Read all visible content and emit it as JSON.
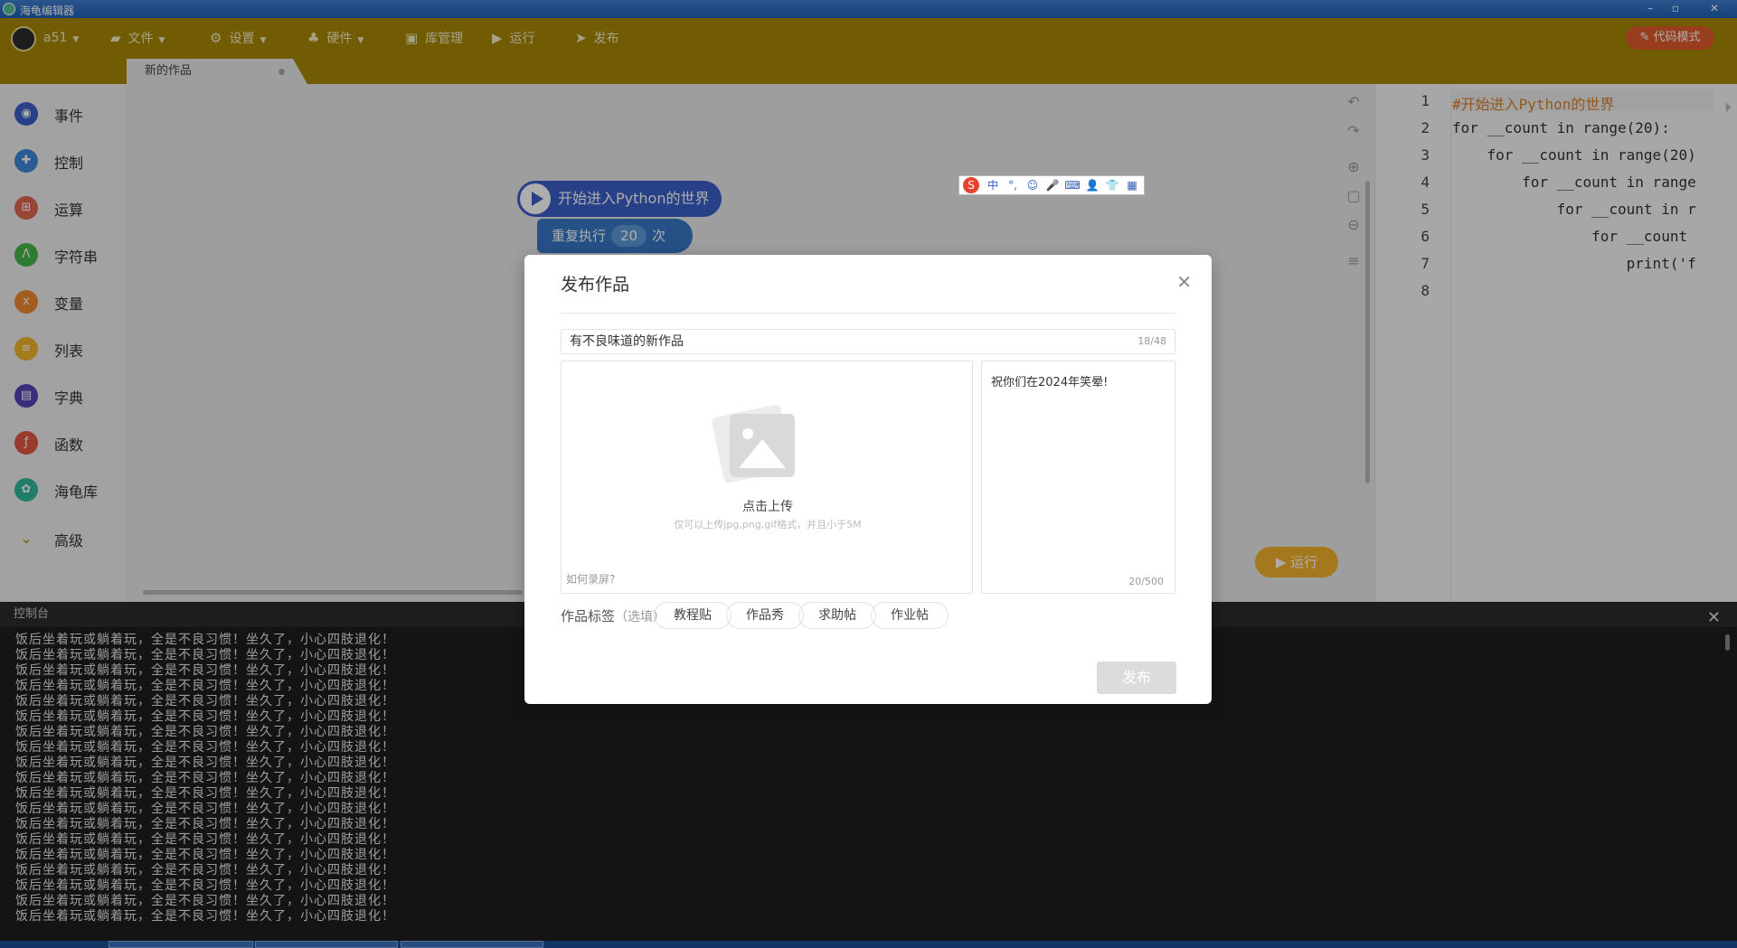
{
  "window": {
    "title": "海龟编辑器",
    "min": "–",
    "max": "▫",
    "close": "✕"
  },
  "toolbar": {
    "user": "a51",
    "file": "文件",
    "settings": "设置",
    "hardware": "硬件",
    "library": "库管理",
    "run": "运行",
    "publish": "发布",
    "code_mode": "代码模式"
  },
  "tabs": [
    {
      "label": "新的作品"
    }
  ],
  "categories": [
    {
      "label": "事件",
      "color": "#3a5fc7",
      "icon": "toggle-icon"
    },
    {
      "label": "控制",
      "color": "#3f86d8",
      "icon": "gamepad-icon"
    },
    {
      "label": "运算",
      "color": "#e0664f",
      "icon": "grid-icon"
    },
    {
      "label": "字符串",
      "color": "#46b54a",
      "icon": "a-icon"
    },
    {
      "label": "变量",
      "color": "#f08a2e",
      "icon": "x-icon"
    },
    {
      "label": "列表",
      "color": "#f1b62a",
      "icon": "list-icon"
    },
    {
      "label": "字典",
      "color": "#5543b7",
      "icon": "book-icon"
    },
    {
      "label": "函数",
      "color": "#e0573f",
      "icon": "function-icon"
    },
    {
      "label": "海龟库",
      "color": "#2fb89a",
      "icon": "turtle-icon"
    },
    {
      "label": "高级",
      "color": "",
      "icon": "chevron-down-icon"
    }
  ],
  "blocks": {
    "start": "开始进入Python的世界",
    "repeat_prefix": "重复执行",
    "repeat_count": "20",
    "repeat_suffix": "次"
  },
  "run_button": "运行",
  "editor": {
    "lines": [
      {
        "n": "1",
        "text": "#开始进入Python的世界"
      },
      {
        "n": "2",
        "text": "for __count in range(20):"
      },
      {
        "n": "3",
        "text": "    for __count in range(20)"
      },
      {
        "n": "4",
        "text": "        for __count in range"
      },
      {
        "n": "5",
        "text": "            for __count in r"
      },
      {
        "n": "6",
        "text": "                for __count"
      },
      {
        "n": "7",
        "text": "                    print('f"
      },
      {
        "n": "8",
        "text": ""
      }
    ]
  },
  "console": {
    "title": "控制台",
    "line": "饭后坐着玩或躺着玩，全是不良习惯！坐久了，小心四肢退化！",
    "line_count": 19
  },
  "ime": {
    "logo": "S",
    "items": [
      "中",
      "°,",
      "☺",
      "🎤",
      "⌨",
      "👤",
      "👕",
      "▦"
    ]
  },
  "dialog": {
    "title": "发布作品",
    "work_title": "有不良味道的新作品",
    "title_count": "18/48",
    "upload_label": "点击上传",
    "upload_hint": "仅可以上传jpg,png,gif格式，并且小于5M",
    "record_link": "如何录屏?",
    "description": "祝你们在2024年笑晕!",
    "desc_count": "20/500",
    "tags_label": "作品标签",
    "tags_optional": "（选填）",
    "tags": [
      "教程贴",
      "作品秀",
      "求助帖",
      "作业帖"
    ],
    "publish": "发布"
  }
}
